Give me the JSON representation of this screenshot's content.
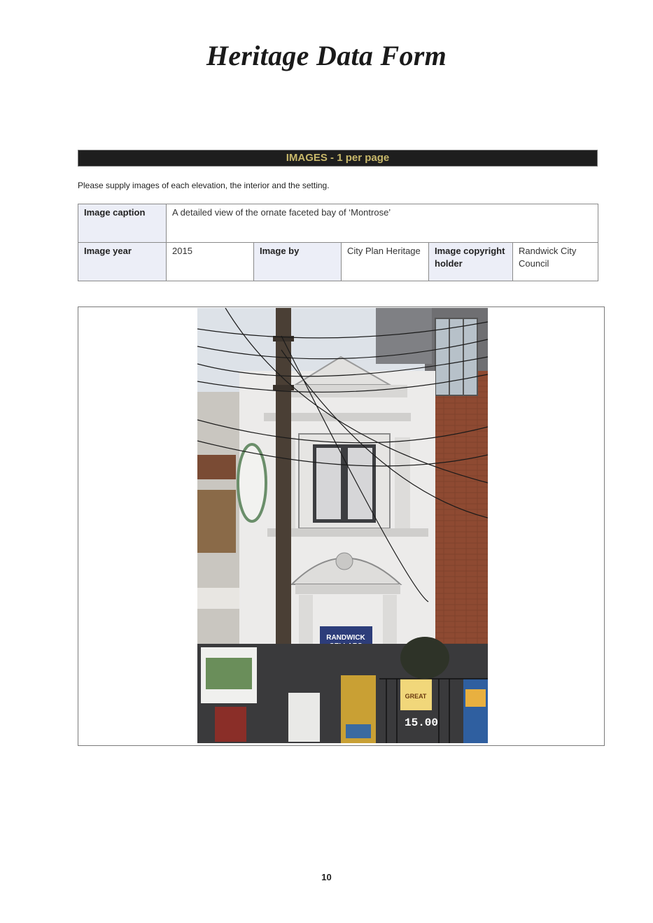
{
  "document": {
    "title": "Heritage Data Form",
    "page_number": "10"
  },
  "images_section": {
    "heading": "IMAGES - 1 per page",
    "instruction": "Please supply images of each elevation, the interior and the setting."
  },
  "image_details": {
    "caption_label": "Image caption",
    "caption_value": "A detailed view of the ornate faceted bay of ‘Montrose’",
    "year_label": "Image year",
    "year_value": "2015",
    "by_label": "Image by",
    "by_value": "City Plan Heritage",
    "copyright_label": "Image copyright holder",
    "copyright_value": "Randwick City Council"
  },
  "photo": {
    "shop_sign_line1": "RANDWICK",
    "shop_sign_line2": "CELLARS",
    "price_sign": "15.00",
    "poster_text": "GREAT"
  },
  "colors": {
    "heading_bar": "#1e1e1e",
    "heading_text": "#c8b86a",
    "label_cell": "#eceef7"
  }
}
